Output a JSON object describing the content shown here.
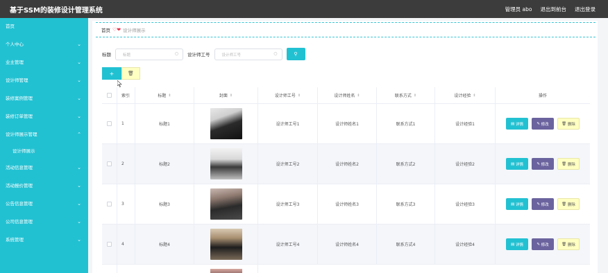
{
  "header": {
    "title": "基于SSM的装修设计管理系统",
    "links": [
      "管理员 abo",
      "退出到前台",
      "退出登录"
    ]
  },
  "sidebar": {
    "items": [
      {
        "label": "首页",
        "has_chevron": false
      },
      {
        "label": "个人中心",
        "has_chevron": true
      },
      {
        "label": "业主管理",
        "has_chevron": true
      },
      {
        "label": "设计师管理",
        "has_chevron": true
      },
      {
        "label": "装修案例管理",
        "has_chevron": true
      },
      {
        "label": "装修订单管理",
        "has_chevron": true
      },
      {
        "label": "设计师展示管理",
        "has_chevron": true,
        "expanded": true
      },
      {
        "label": "设计师展示",
        "sub": true
      },
      {
        "label": "活动信息管理",
        "has_chevron": true
      },
      {
        "label": "活动报价管理",
        "has_chevron": true
      },
      {
        "label": "公告信息管理",
        "has_chevron": true
      },
      {
        "label": "公司信息管理",
        "has_chevron": true
      },
      {
        "label": "系统管理",
        "has_chevron": true
      }
    ]
  },
  "breadcrumb": {
    "home": "首页",
    "current": "设计师展示"
  },
  "search": {
    "title_label": "标题",
    "title_placeholder": "标题",
    "designer_no_label": "设计师工号",
    "designer_no_placeholder": "设计师工号",
    "search_icon": "search-icon"
  },
  "actions": {
    "add_icon": "plus-icon",
    "delete_icon": "trash-icon"
  },
  "table": {
    "headers": [
      "索引",
      "标题",
      "封面",
      "设计师工号",
      "设计师姓名",
      "联系方式",
      "设计经验",
      "操作"
    ],
    "buttons": {
      "detail": "详情",
      "edit": "修改",
      "delete": "删除"
    },
    "rows": [
      {
        "index": "1",
        "title": "标题1",
        "designer_no": "设计师工号1",
        "designer_name": "设计师姓名1",
        "contact": "联系方式1",
        "experience": "设计经验1"
      },
      {
        "index": "2",
        "title": "标题2",
        "designer_no": "设计师工号2",
        "designer_name": "设计师姓名2",
        "contact": "联系方式2",
        "experience": "设计经验2"
      },
      {
        "index": "3",
        "title": "标题3",
        "designer_no": "设计师工号3",
        "designer_name": "设计师姓名3",
        "contact": "联系方式3",
        "experience": "设计经验3"
      },
      {
        "index": "4",
        "title": "标题4",
        "designer_no": "设计师工号4",
        "designer_name": "设计师姓名4",
        "contact": "联系方式4",
        "experience": "设计经验4"
      }
    ]
  },
  "colors": {
    "accent": "#22c1d2",
    "edit": "#6a639e",
    "delete": "#ffffc2",
    "topbar": "#3c3c3c"
  }
}
